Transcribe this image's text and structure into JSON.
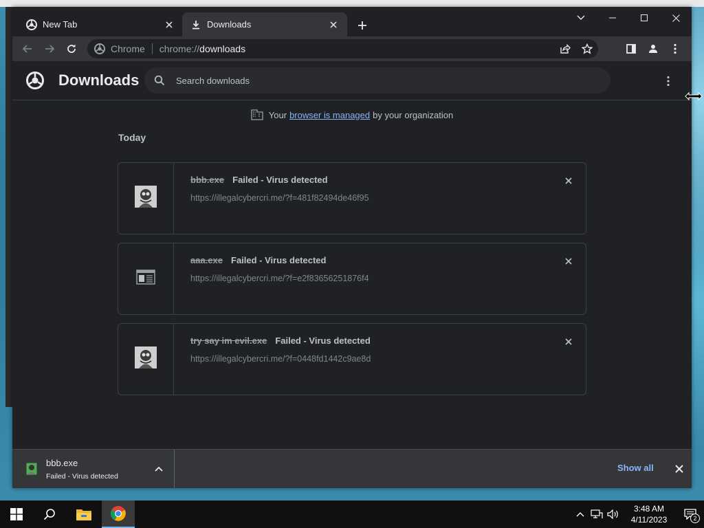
{
  "browser": {
    "tabs": [
      {
        "label": "New Tab",
        "active": false
      },
      {
        "label": "Downloads",
        "active": true
      }
    ],
    "omnibox": {
      "scheme_label": "Chrome",
      "url_scheme": "chrome://",
      "url_host": "downloads"
    }
  },
  "downloads_page": {
    "title": "Downloads",
    "search_placeholder": "Search downloads",
    "managed_notice": {
      "prefix": "Your",
      "link": "browser is managed",
      "suffix": "by your organization"
    },
    "section_label": "Today",
    "items": [
      {
        "file_name": "bbb.exe",
        "status": "Failed - Virus detected",
        "url": "https://illegalcybercri.me/?f=481f82494de46f95",
        "icon": "photo-thumbnail-icon"
      },
      {
        "file_name": "aaa.exe",
        "status": "Failed - Virus detected",
        "url": "https://illegalcybercri.me/?f=e2f83656251876f4",
        "icon": "generic-file-icon"
      },
      {
        "file_name": "try say im evil.exe",
        "status": "Failed - Virus detected",
        "url": "https://illegalcybercri.me/?f=0448fd1442c9ae8d",
        "icon": "photo-thumbnail-icon"
      }
    ]
  },
  "download_shelf": {
    "item_name": "bbb.exe",
    "item_status": "Failed - Virus detected",
    "show_all_label": "Show all"
  },
  "taskbar": {
    "time": "3:48 AM",
    "date": "4/11/2023",
    "notification_count": "2"
  },
  "colors": {
    "page_bg": "#202124",
    "toolbar_bg": "#35363a",
    "link": "#8ab4f8",
    "text_primary": "#e8eaed",
    "text_secondary": "#bdc1c6"
  }
}
